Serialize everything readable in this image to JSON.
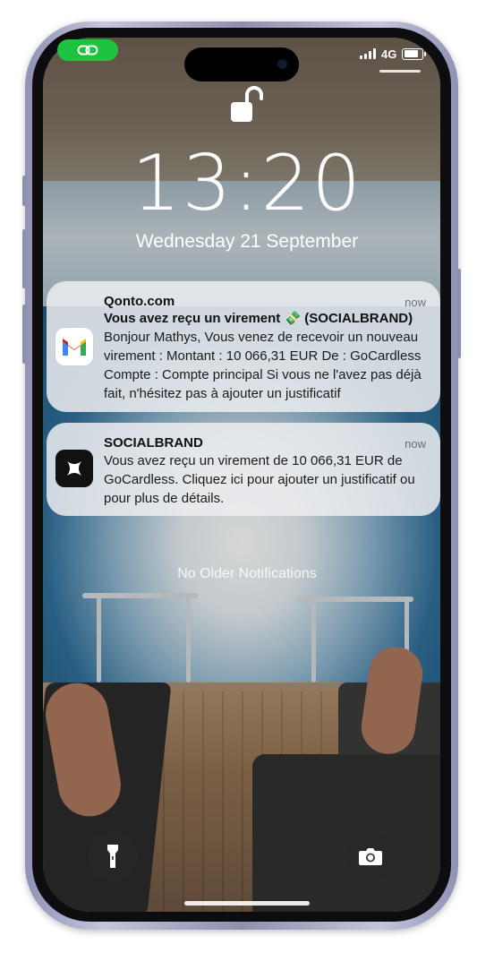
{
  "status_bar": {
    "network": "4G",
    "link_indicator_color": "#1fc33f"
  },
  "lock_screen": {
    "time": "13:20",
    "date": "Wednesday 21 September"
  },
  "notifications": [
    {
      "app": "Qonto.com",
      "icon": "gmail-icon",
      "title": "Vous avez reçu un virement 💸 (SOCIALBRAND)",
      "body": "Bonjour Mathys, Vous venez de recevoir un nouveau virement : Montant : 10 066,31 EUR De : GoCardless Compte : Compte principal Si vous ne l'avez pas déjà fait, n'hésitez pas à ajouter un justificatif",
      "time": "now"
    },
    {
      "app": "SOCIALBRAND",
      "icon": "socialbrand-x-icon",
      "body": "Vous avez reçu un virement de 10 066,31 EUR de GoCardless. Cliquez ici pour ajouter un justificatif ou pour plus de détails.",
      "time": "now"
    }
  ],
  "footer_text": "No Older Notifications",
  "quick_actions": {
    "left": "flashlight-icon",
    "right": "camera-icon"
  }
}
